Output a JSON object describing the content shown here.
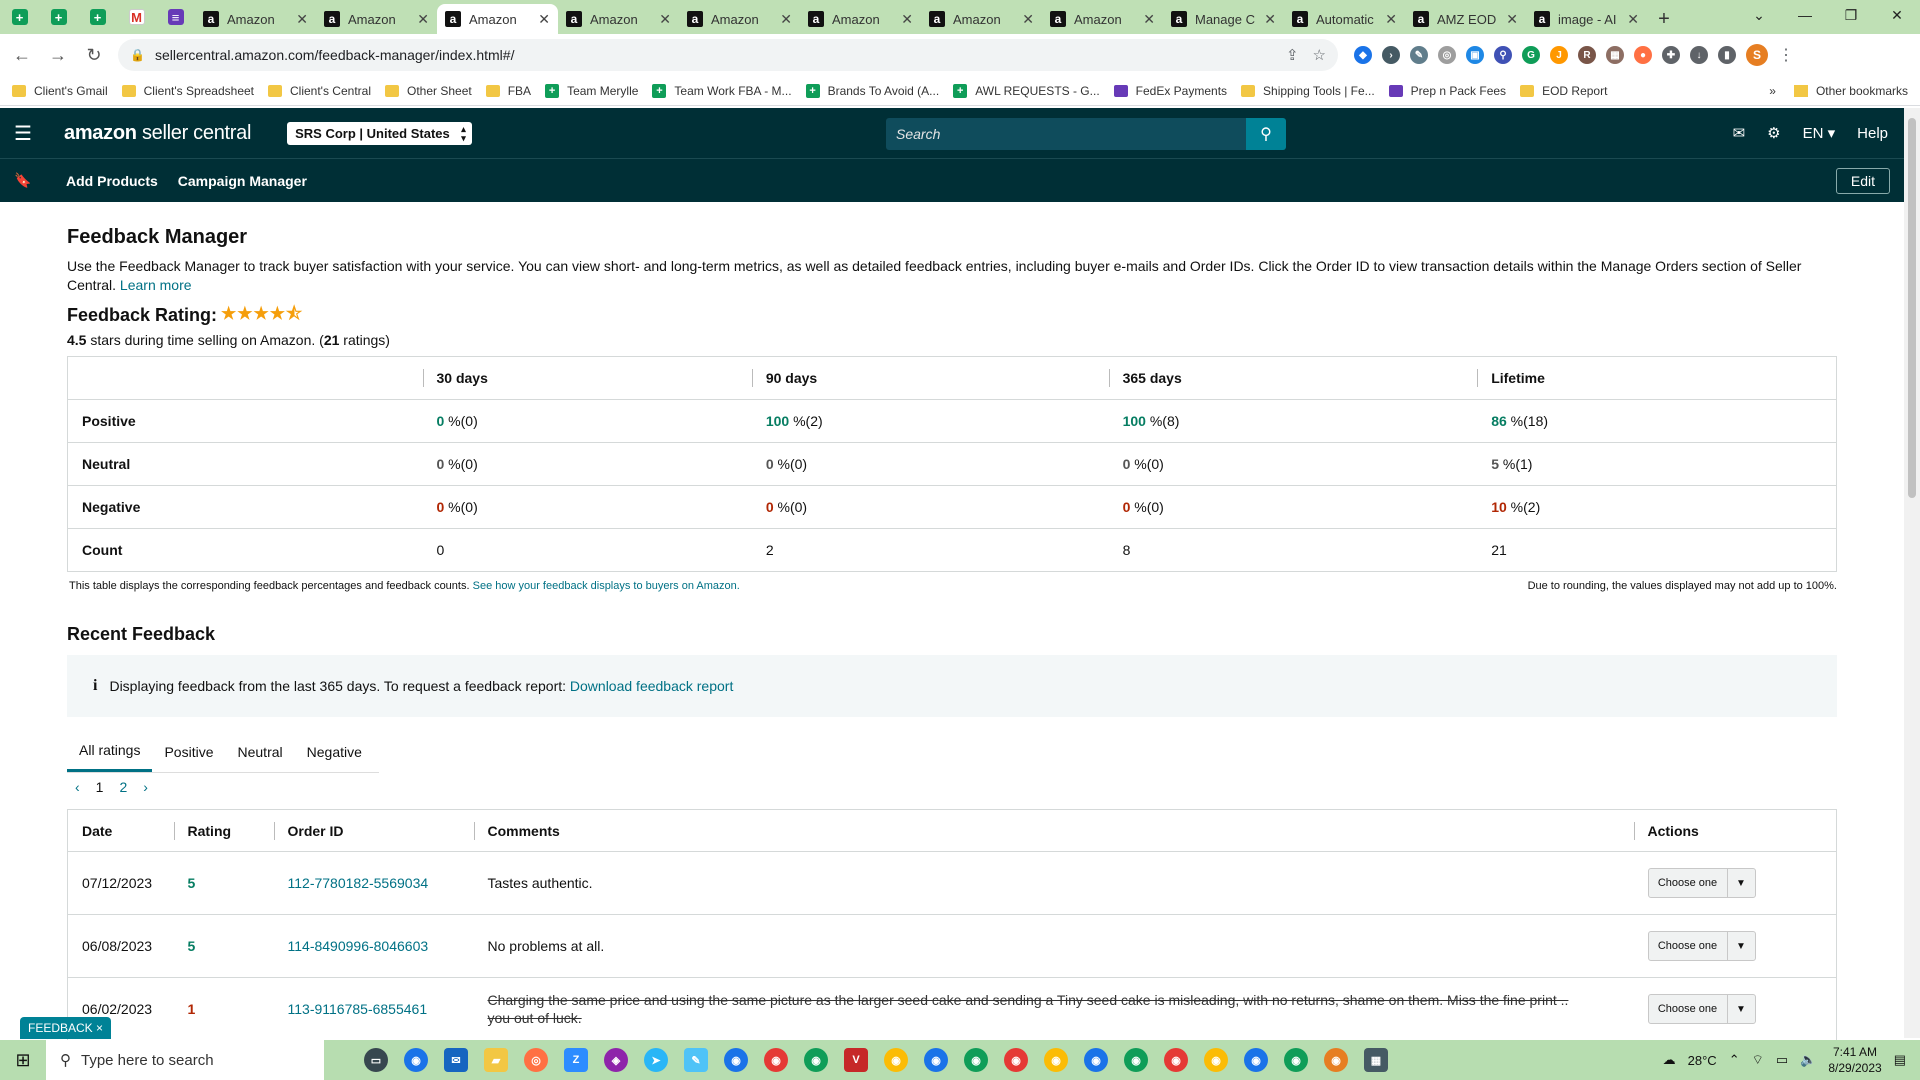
{
  "browser": {
    "tabs": [
      {
        "title": "Amazon",
        "active": false
      },
      {
        "title": "Amazon",
        "active": false
      },
      {
        "title": "Amazon",
        "active": true
      },
      {
        "title": "Amazon",
        "active": false
      },
      {
        "title": "Amazon",
        "active": false
      },
      {
        "title": "Amazon",
        "active": false
      },
      {
        "title": "Amazon",
        "active": false
      },
      {
        "title": "Amazon",
        "active": false
      },
      {
        "title": "Manage C",
        "active": false
      },
      {
        "title": "Automatic",
        "active": false
      },
      {
        "title": "AMZ EOD",
        "active": false
      },
      {
        "title": "image - AI",
        "active": false
      }
    ],
    "url": "sellercentral.amazon.com/feedback-manager/index.html#/",
    "profile_initial": "S",
    "bookmarks": [
      "Client's Gmail",
      "Client's Spreadsheet",
      "Client's Central",
      "Other Sheet",
      "FBA",
      "Team Merylle",
      "Team Work FBA - M...",
      "Brands To Avoid (A...",
      "AWL REQUESTS - G...",
      "FedEx Payments",
      "Shipping Tools | Fe...",
      "Prep n Pack Fees",
      "EOD Report"
    ],
    "bookmarks_more": "»",
    "other_bookmarks": "Other bookmarks"
  },
  "header": {
    "logo_main": "amazon",
    "logo_sub": "seller central",
    "account": "SRS Corp | United States",
    "search_placeholder": "Search",
    "language": "EN",
    "help": "Help",
    "nav": [
      "Add Products",
      "Campaign Manager"
    ],
    "edit": "Edit"
  },
  "page": {
    "title": "Feedback Manager",
    "description": "Use the Feedback Manager to track buyer satisfaction with your service. You can view short- and long-term metrics, as well as detailed feedback entries, including buyer e-mails and Order IDs. Click the Order ID to view transaction details within the Manage Orders section of Seller Central.",
    "learn_more": "Learn more",
    "rating_label": "Feedback Rating:",
    "rating_value": 4.5,
    "stars_text": "4.5",
    "stars_suffix": " stars during time selling on Amazon. (",
    "ratings_count": "21",
    "ratings_suffix": " ratings)"
  },
  "summary": {
    "columns": [
      "30 days",
      "90 days",
      "365 days",
      "Lifetime"
    ],
    "rows": [
      {
        "label": "Positive",
        "cells": [
          [
            "0",
            " %(0)"
          ],
          [
            "100",
            " %(2)"
          ],
          [
            "100",
            " %(8)"
          ],
          [
            "86",
            " %(18)"
          ]
        ],
        "cls": "g"
      },
      {
        "label": "Neutral",
        "cells": [
          [
            "0",
            " %(0)"
          ],
          [
            "0",
            " %(0)"
          ],
          [
            "0",
            " %(0)"
          ],
          [
            "5",
            " %(1)"
          ]
        ],
        "cls": "z"
      },
      {
        "label": "Negative",
        "cells": [
          [
            "0",
            " %(0)"
          ],
          [
            "0",
            " %(0)"
          ],
          [
            "0",
            " %(0)"
          ],
          [
            "10",
            " %(2)"
          ]
        ],
        "cls": "r"
      },
      {
        "label": "Count",
        "cells": [
          [
            "0",
            ""
          ],
          [
            "2",
            ""
          ],
          [
            "8",
            ""
          ],
          [
            "21",
            ""
          ]
        ],
        "cls": ""
      }
    ],
    "note_left": "This table displays the corresponding feedback percentages and feedback counts.",
    "note_link": "See how your feedback displays to buyers on Amazon.",
    "note_right": "Due to rounding, the values displayed may not add up to 100%."
  },
  "recent": {
    "title": "Recent Feedback",
    "info_icon": "i",
    "info_text": "Displaying feedback from the last 365 days. To request a feedback report:",
    "info_link": "Download feedback report",
    "tabs": [
      "All ratings",
      "Positive",
      "Neutral",
      "Negative"
    ],
    "pages": [
      "1",
      "2"
    ],
    "columns": [
      "Date",
      "Rating",
      "Order ID",
      "Comments",
      "Actions"
    ],
    "rows": [
      {
        "date": "07/12/2023",
        "rating": "5",
        "order": "112-7780182-5569034",
        "comment": "Tastes authentic.",
        "struck": false
      },
      {
        "date": "06/08/2023",
        "rating": "5",
        "order": "114-8490996-8046603",
        "comment": "No problems at all.",
        "struck": false
      },
      {
        "date": "06/02/2023",
        "rating": "1",
        "order": "113-9116785-6855461",
        "comment": "Charging the same price and using the same picture as the larger seed cake and sending a Tiny seed cake is misleading, with no returns, shame on them. Miss the fine print .. you out of luck.",
        "struck": true
      }
    ],
    "action_label": "Choose one"
  },
  "feedback_tag": "FEEDBACK ×",
  "taskbar": {
    "search": "Type here to search",
    "weather": "28°C",
    "time": "7:41 AM",
    "date": "8/29/2023"
  }
}
